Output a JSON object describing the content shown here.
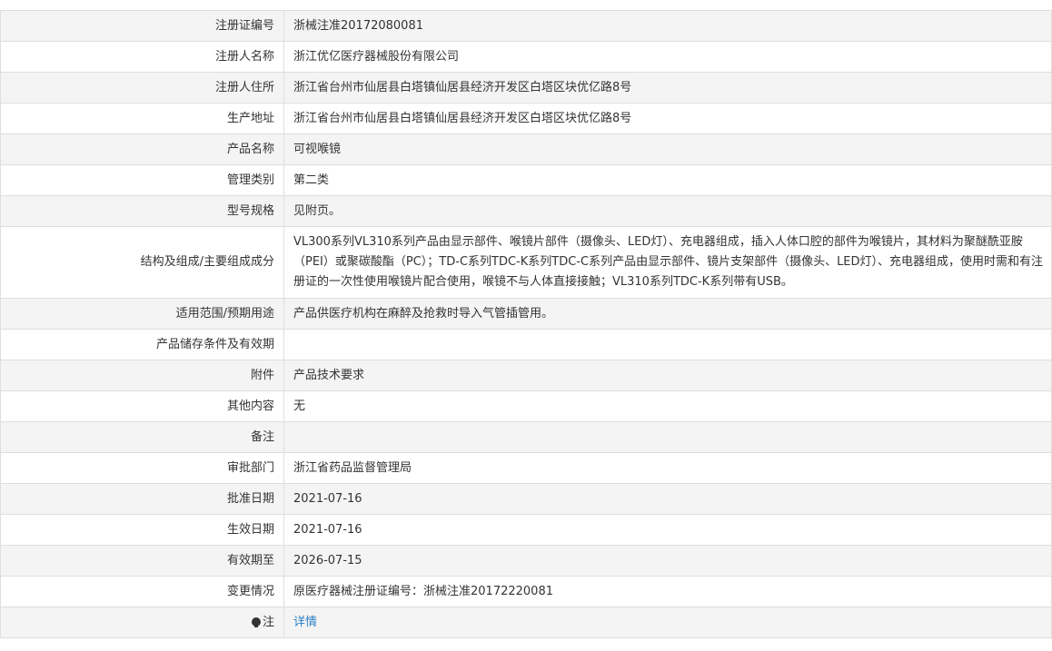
{
  "rows": [
    {
      "label": "注册证编号",
      "value": "浙械注准20172080081"
    },
    {
      "label": "注册人名称",
      "value": "浙江优亿医疗器械股份有限公司"
    },
    {
      "label": "注册人住所",
      "value": "浙江省台州市仙居县白塔镇仙居县经济开发区白塔区块优亿路8号"
    },
    {
      "label": "生产地址",
      "value": "浙江省台州市仙居县白塔镇仙居县经济开发区白塔区块优亿路8号"
    },
    {
      "label": "产品名称",
      "value": "可视喉镜"
    },
    {
      "label": "管理类别",
      "value": "第二类"
    },
    {
      "label": "型号规格",
      "value": "见附页。"
    },
    {
      "label": "结构及组成/主要组成成分",
      "value": "VL300系列VL310系列产品由显示部件、喉镜片部件（摄像头、LED灯）、充电器组成，插入人体口腔的部件为喉镜片，其材料为聚醚酰亚胺（PEI）或聚碳酸酯（PC）；TD-C系列TDC-K系列TDC-C系列产品由显示部件、镜片支架部件（摄像头、LED灯）、充电器组成，使用时需和有注册证的一次性使用喉镜片配合使用，喉镜不与人体直接接触；VL310系列TDC-K系列带有USB。"
    },
    {
      "label": "适用范围/预期用途",
      "value": "产品供医疗机构在麻醉及抢救时导入气管插管用。"
    },
    {
      "label": "产品储存条件及有效期",
      "value": ""
    },
    {
      "label": "附件",
      "value": "产品技术要求"
    },
    {
      "label": "其他内容",
      "value": "无"
    },
    {
      "label": "备注",
      "value": ""
    },
    {
      "label": "审批部门",
      "value": "浙江省药品监督管理局"
    },
    {
      "label": "批准日期",
      "value": "2021-07-16"
    },
    {
      "label": "生效日期",
      "value": "2021-07-16"
    },
    {
      "label": "有效期至",
      "value": "2026-07-15"
    },
    {
      "label": "变更情况",
      "value": "原医疗器械注册证编号：浙械注准20172220081"
    }
  ],
  "note_row": {
    "label": "注",
    "icon": "bulb-icon",
    "link_text": "详情"
  },
  "colors": {
    "border": "#dedede",
    "stripe": "#f4f4f4",
    "link": "#2a7fc7"
  }
}
